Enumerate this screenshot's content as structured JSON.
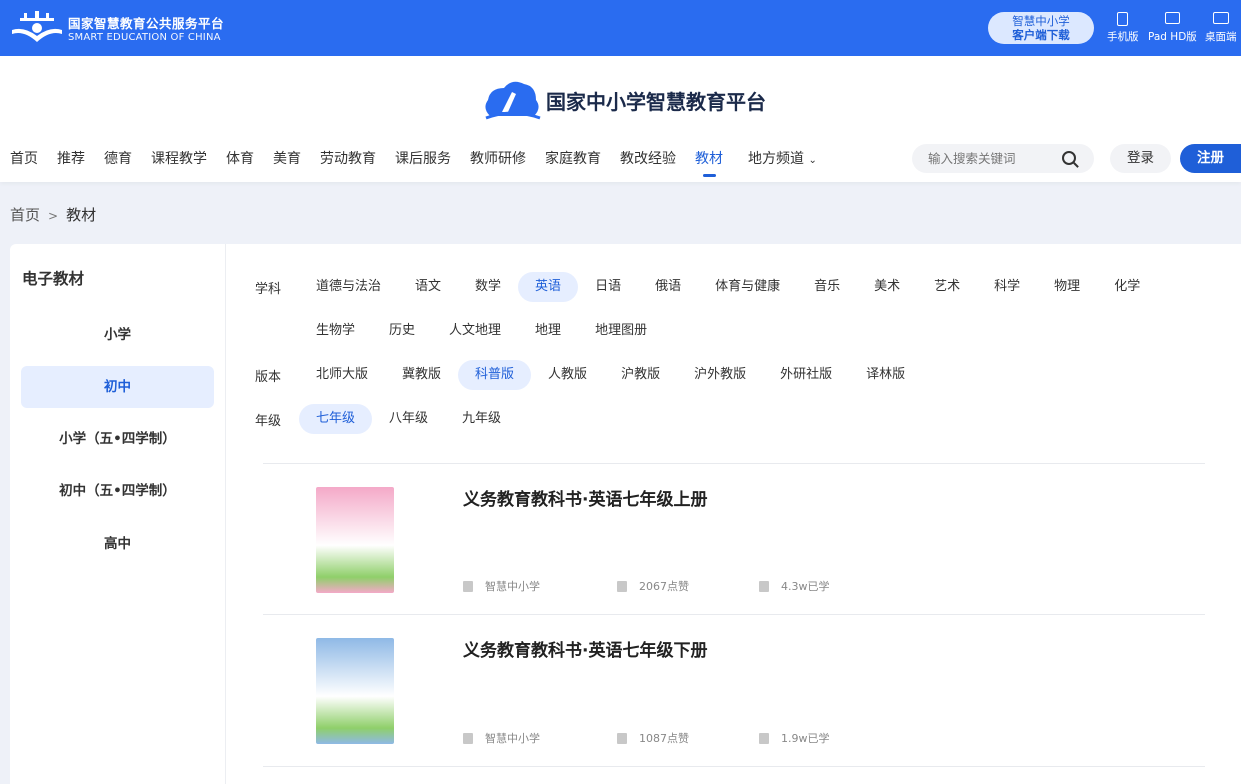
{
  "topbar": {
    "brand_cn": "国家智慧教育公共服务平台",
    "brand_en": "SMART EDUCATION OF CHINA",
    "download_line1": "智慧中小学",
    "download_line2": "客户端下载",
    "devices": [
      "手机版",
      "Pad HD版",
      "桌面端"
    ]
  },
  "header": {
    "site_title": "国家中小学智慧教育平台",
    "nav": [
      "首页",
      "推荐",
      "德育",
      "课程教学",
      "体育",
      "美育",
      "劳动教育",
      "课后服务",
      "教师研修",
      "家庭教育",
      "教改经验",
      "教材",
      "地方频道"
    ],
    "active_nav": "教材",
    "search_placeholder": "输入搜索关键词",
    "login": "登录",
    "register": "注册"
  },
  "breadcrumb": {
    "home": "首页",
    "sep": ">",
    "current": "教材"
  },
  "sidebar": {
    "title": "电子教材",
    "items": [
      "小学",
      "初中",
      "小学（五•四学制）",
      "初中（五•四学制）",
      "高中"
    ],
    "active": "初中"
  },
  "filters": {
    "subject_label": "学科",
    "subjects_row1": [
      "道德与法治",
      "语文",
      "数学",
      "英语",
      "日语",
      "俄语",
      "体育与健康",
      "音乐",
      "美术",
      "艺术",
      "科学",
      "物理",
      "化学"
    ],
    "subjects_row2": [
      "生物学",
      "历史",
      "人文地理",
      "地理",
      "地理图册"
    ],
    "active_subject": "英语",
    "edition_label": "版本",
    "editions": [
      "北师大版",
      "冀教版",
      "科普版",
      "人教版",
      "沪教版",
      "沪外教版",
      "外研社版",
      "译林版"
    ],
    "active_edition": "科普版",
    "grade_label": "年级",
    "grades": [
      "七年级",
      "八年级",
      "九年级"
    ],
    "active_grade": "七年级"
  },
  "books": [
    {
      "title": "义务教育教科书·英语七年级上册",
      "publisher": "智慧中小学",
      "likes": "2067点赞",
      "learners": "4.3w已学",
      "cover_color": "#f4a9c8"
    },
    {
      "title": "义务教育教科书·英语七年级下册",
      "publisher": "智慧中小学",
      "likes": "1087点赞",
      "learners": "1.9w已学",
      "cover_color": "#8fb9e6"
    }
  ]
}
